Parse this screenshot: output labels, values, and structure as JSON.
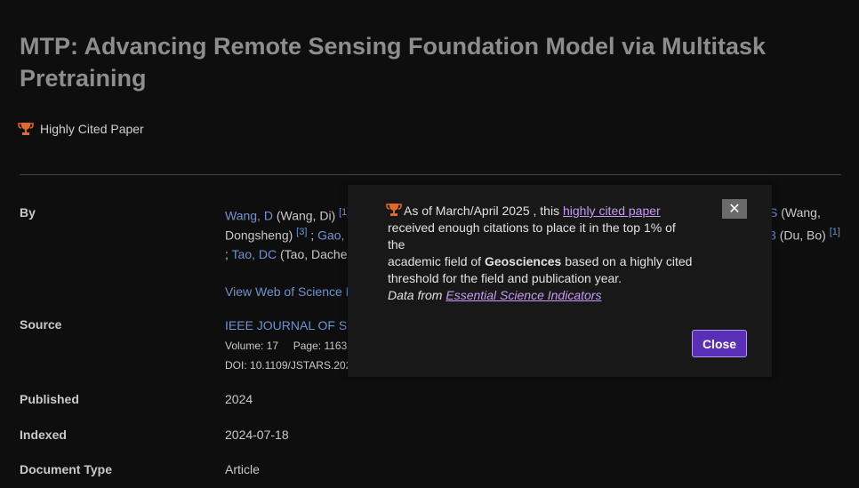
{
  "title": "MTP: Advancing Remote Sensing Foundation Model via Multitask Pretraining",
  "badge": {
    "label": "Highly Cited Paper",
    "icon": "trophy-icon"
  },
  "fields": {
    "by_label": "By",
    "source_label": "Source",
    "published_label": "Published",
    "indexed_label": "Indexed",
    "doctype_label": "Document Type"
  },
  "authors": {
    "a1_link": "Wang, D",
    "a1_full": "(Wang, Di)",
    "a1_sup": "[1]",
    "sep1": ";",
    "a2_tail": "S",
    "a2_full_part1": "(Wang,",
    "a2_full_part2": "Dongsheng)",
    "a2_sup": "[3]",
    "sep2": ";",
    "a3_link_part": "Gao, E",
    "a4_tail": "3",
    "a4_full": "(Du, Bo)",
    "a4_sup": "[1]",
    "sep3": ";",
    "a5_link": "Tao, DC",
    "a5_full": "(Tao, Dacheng"
  },
  "view_link": "View Web of Science Re",
  "source": {
    "journal": "IEEE JOURNAL OF SELE",
    "volume_label": "Volume:",
    "volume": "17",
    "page_label": "Page:",
    "page": "11632",
    "doi_label": "DOI:",
    "doi": "10.1109/JSTARS.2024"
  },
  "published": "2024",
  "indexed": "2024-07-18",
  "doctype": "Article",
  "popup": {
    "line1_pre": "As of March/April 2025 , this ",
    "line1_link": "highly cited paper",
    "line2": "received enough citations to place it in the top 1% of the",
    "line3_pre": "academic field of ",
    "line3_bold": "Geosciences",
    "line3_post": " based on a highly cited",
    "line4": "threshold for the field and publication year.",
    "data_pre": "Data from ",
    "data_link": "Essential Science Indicators",
    "x_label": "✕",
    "close_label": "Close"
  },
  "colors": {
    "accent": "#5a2fb7",
    "link": "#6e93cf",
    "popup_link": "#c79bf7",
    "trophy": "#e06a2a"
  }
}
